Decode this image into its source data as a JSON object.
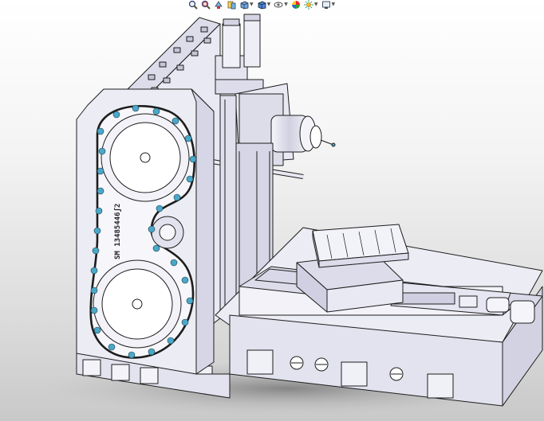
{
  "toolbar": {
    "buttons": [
      {
        "name": "zoom-to-fit-icon",
        "has_menu": false
      },
      {
        "name": "zoom-to-area-icon",
        "has_menu": false
      },
      {
        "name": "previous-view-icon",
        "has_menu": false
      },
      {
        "name": "section-view-icon",
        "has_menu": false
      },
      {
        "name": "view-orientation-icon",
        "has_menu": true
      },
      {
        "name": "display-style-icon",
        "has_menu": true
      },
      {
        "name": "hide-show-items-icon",
        "has_menu": true
      },
      {
        "name": "edit-appearance-icon",
        "has_menu": false
      },
      {
        "name": "apply-scene-icon",
        "has_menu": true
      },
      {
        "name": "view-settings-icon",
        "has_menu": true
      }
    ]
  },
  "model": {
    "engraved_text": "SM 13485446ʃ2",
    "colors": {
      "body": "#e6e6f2",
      "body_shade": "#c9c9dc",
      "edge": "#1d1d1d",
      "bolt": "#4aa8c8",
      "shadow": "#9a9a9a"
    }
  }
}
